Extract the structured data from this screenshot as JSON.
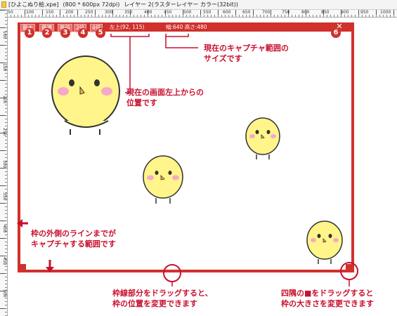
{
  "titlebar": {
    "filename": "[ひよこぬり絵.xpe]",
    "size": "(800 * 600px 72dpi)",
    "layer": "レイヤー 2(ラスターレイヤー カラー(32bit))"
  },
  "ruler": {
    "h_labels": [
      "50",
      "100",
      "150",
      "200",
      "250",
      "300",
      "350",
      "400",
      "450",
      "500",
      "550",
      "600",
      "650",
      "700",
      "750",
      "800",
      "850",
      "900",
      "950",
      "1000"
    ],
    "v_labels": [
      "100",
      "150",
      "200",
      "250",
      "300",
      "350",
      "400",
      "450",
      "500"
    ]
  },
  "capture_toolbar": {
    "buttons": [
      "最大",
      "最適",
      "等倍",
      "2倍",
      "4倍"
    ],
    "position": "左上(92, 115)",
    "size": "幅:640 高さ:480",
    "close": "✕"
  },
  "badges": [
    "1",
    "2",
    "3",
    "4",
    "5",
    "6"
  ],
  "annotations": {
    "size_note": [
      "現在のキャプチャ範囲の",
      "サイズです"
    ],
    "position_note": [
      "現在の画面左上からの",
      "位置です"
    ],
    "edge_note": [
      "枠の外側のラインまでが",
      "キャプチャする範囲です"
    ],
    "drag_frame_note": [
      "枠線部分をドラッグすると、",
      "枠の位置を変更できます"
    ],
    "drag_corner_note": [
      "四隅の■をドラッグすると",
      "枠の大きさを変更できます"
    ]
  },
  "colors": {
    "frame": "#d0312d",
    "annotation": "#c8102e",
    "chick_body": "#fff58a",
    "cheek": "#f7a8c8"
  }
}
